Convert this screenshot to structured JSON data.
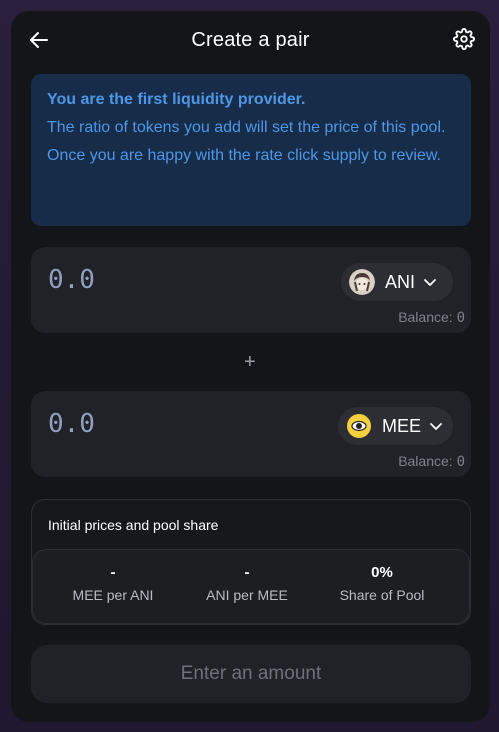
{
  "header": {
    "title": "Create a pair",
    "back_icon": "arrow-left-icon",
    "settings_icon": "gear-icon"
  },
  "info": {
    "heading": "You are the first liquidity provider.",
    "line1": "The ratio of tokens you add will set the price of this pool.",
    "line2": "Once you are happy with the rate click supply to review."
  },
  "inputs": [
    {
      "placeholder": "0.0",
      "token": "ANI",
      "balance_label": "Balance:",
      "balance_value": "0"
    },
    {
      "placeholder": "0.0",
      "token": "MEE",
      "balance_label": "Balance:",
      "balance_value": "0"
    }
  ],
  "plus_symbol": "+",
  "prices": {
    "title": "Initial prices and pool share",
    "stats": [
      {
        "value": "-",
        "label": "MEE per ANI"
      },
      {
        "value": "-",
        "label": "ANI per MEE"
      },
      {
        "value": "0%",
        "label": "Share of Pool"
      }
    ]
  },
  "cta_label": "Enter an amount",
  "colors": {
    "info_bg": "#172c49",
    "info_text": "#4f97e6",
    "card_bg": "#141518",
    "panel_bg": "#202227",
    "mee_yellow": "#f4d03f"
  }
}
